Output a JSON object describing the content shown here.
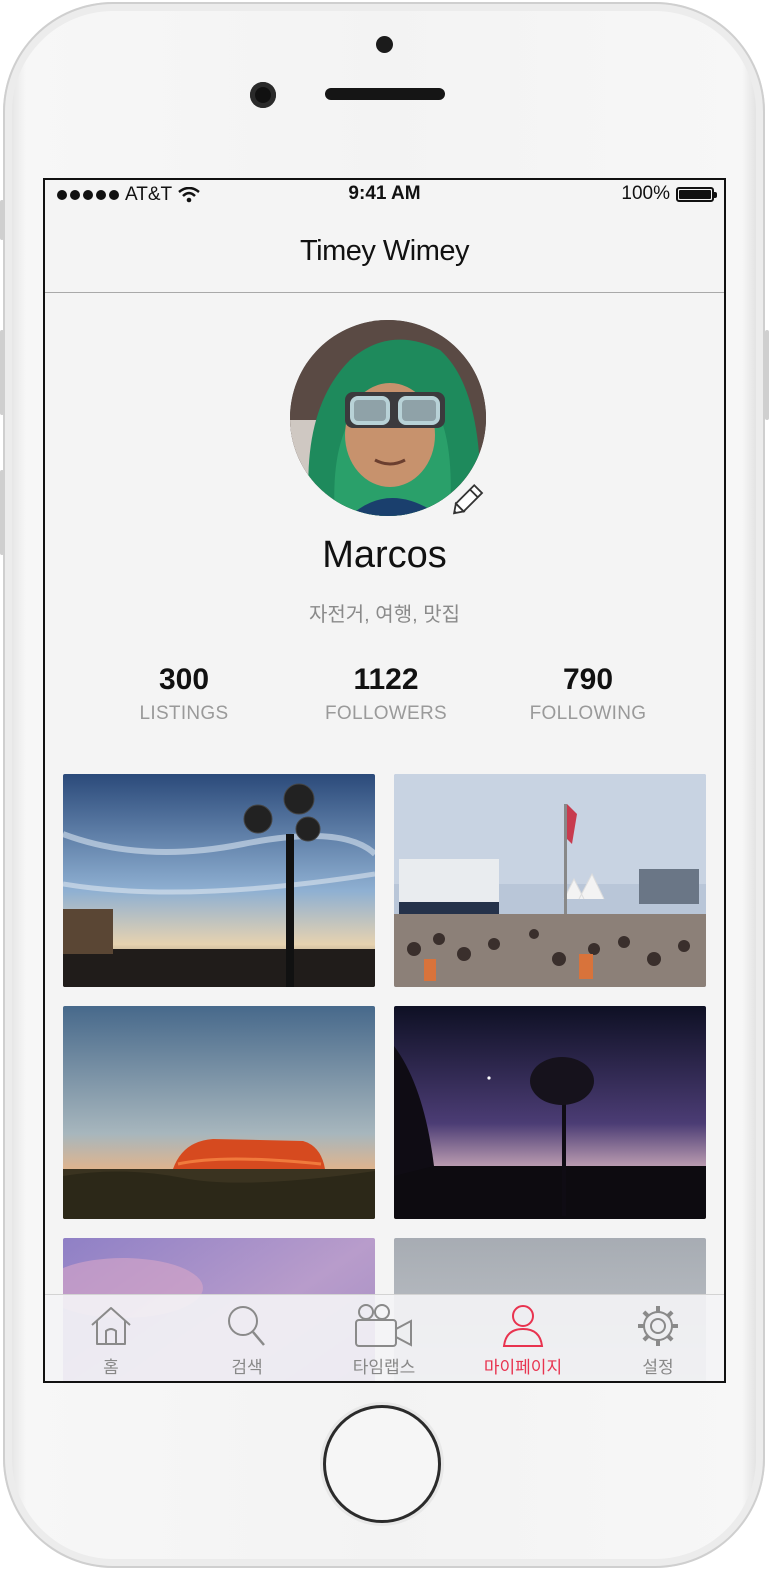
{
  "status_bar": {
    "carrier": "AT&T",
    "time": "9:41 AM",
    "battery": "100%"
  },
  "nav": {
    "title": "Timey Wimey"
  },
  "profile": {
    "name": "Marcos",
    "tags": "자전거, 여행, 맛집",
    "stats": [
      {
        "value": "300",
        "label": "LISTINGS"
      },
      {
        "value": "1122",
        "label": "FOLLOWERS"
      },
      {
        "value": "790",
        "label": "FOLLOWING"
      }
    ]
  },
  "tabs": [
    {
      "label": "홈",
      "icon": "home-icon",
      "active": false
    },
    {
      "label": "검색",
      "icon": "search-icon",
      "active": false
    },
    {
      "label": "타임랩스",
      "icon": "video-camera-icon",
      "active": false
    },
    {
      "label": "마이페이지",
      "icon": "person-icon",
      "active": true
    },
    {
      "label": "설정",
      "icon": "gear-icon",
      "active": false
    }
  ],
  "colors": {
    "accent": "#e8334f",
    "text_secondary": "#9a9a9a",
    "background": "#f4f4f4"
  }
}
